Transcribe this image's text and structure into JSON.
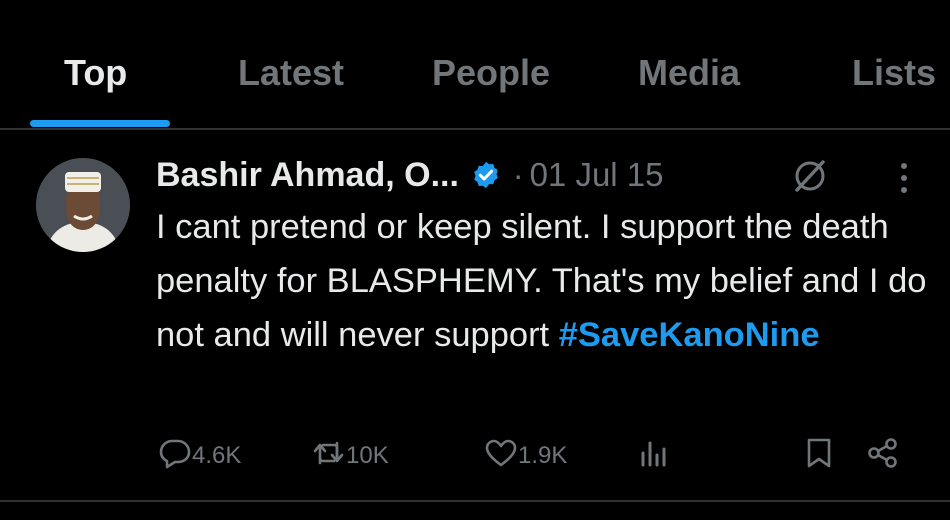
{
  "tabs": [
    {
      "label": "Top",
      "active": true
    },
    {
      "label": "Latest",
      "active": false
    },
    {
      "label": "People",
      "active": false
    },
    {
      "label": "Media",
      "active": false
    },
    {
      "label": "Lists",
      "active": false
    }
  ],
  "tweet": {
    "author_name": "Bashir Ahmad, O...",
    "separator": "·",
    "date": "01 Jul 15",
    "text_before_hashtag": "I cant pretend or keep silent. I support the death penalty for BLASPHEMY. That's my belief and I do not and will never support ",
    "hashtag": "#SaveKanoNine",
    "icons": {
      "verified": "verified-badge-icon",
      "grok": "grok-icon",
      "more": "more-options-icon"
    }
  },
  "actions": {
    "replies": "4.6K",
    "reposts": "10K",
    "likes": "1.9K",
    "icons": [
      "reply-icon",
      "repost-icon",
      "like-icon",
      "views-icon",
      "bookmark-icon",
      "share-icon"
    ]
  },
  "colors": {
    "background": "#000000",
    "text_primary": "#e7e9ea",
    "text_secondary": "#71767b",
    "accent": "#1d9bf0",
    "divider": "#2f3336"
  }
}
